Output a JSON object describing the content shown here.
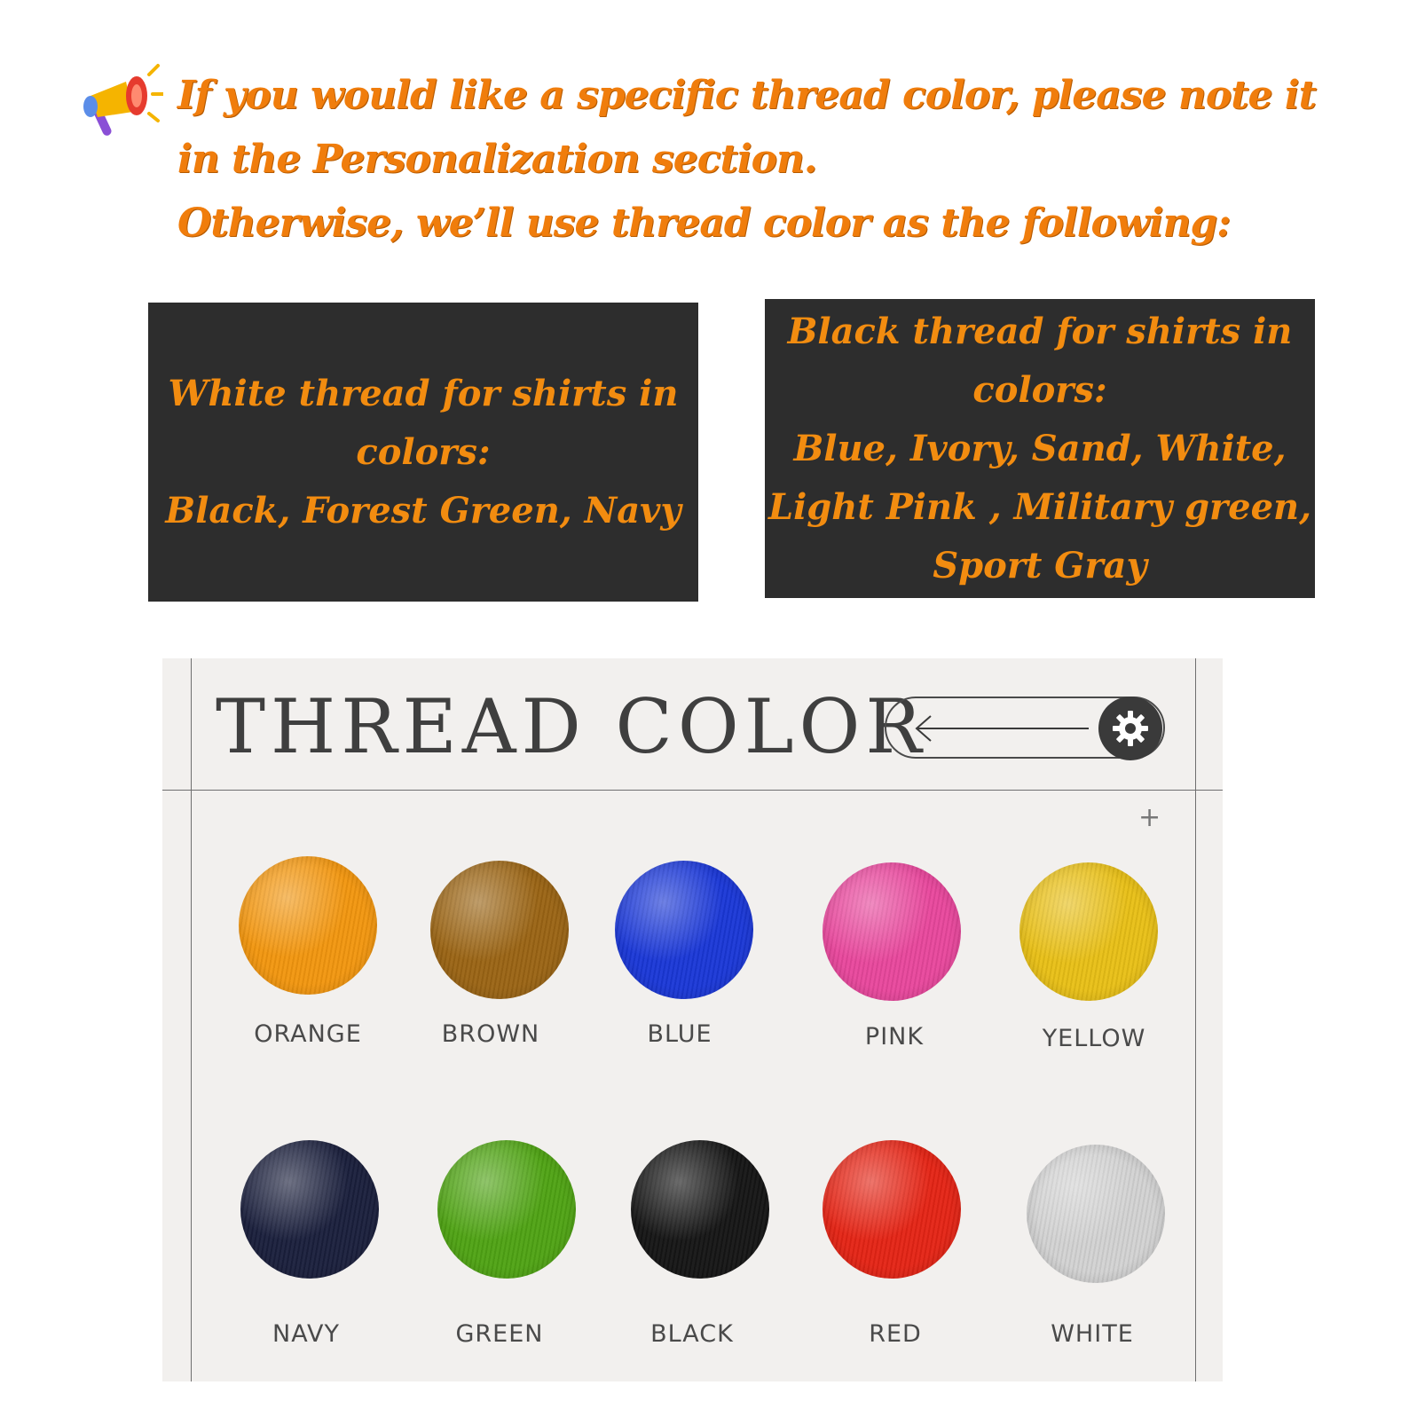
{
  "notice": {
    "icon": "megaphone-icon",
    "lines": [
      "If you would like a specific thread color, please note it",
      "in the Personalization section.",
      "Otherwise, we’ll use thread color as the following:"
    ]
  },
  "boxes": {
    "white_thread": {
      "lines": [
        "White thread for shirts in",
        "colors:",
        "Black, Forest Green, Navy"
      ]
    },
    "black_thread": {
      "lines": [
        "Black thread for shirts in",
        "colors:",
        "Blue, Ivory, Sand, White,",
        "Light Pink , Military green,",
        "Sport Gray"
      ]
    }
  },
  "panel": {
    "title": "THREAD COLOR",
    "toggle_icon": "arrow-left-icon",
    "settings_icon": "gear-icon",
    "plus_symbol": "+",
    "swatches": [
      {
        "label": "ORANGE",
        "color": "#f2960f"
      },
      {
        "label": "BROWN",
        "color": "#9a6414"
      },
      {
        "label": "BLUE",
        "color": "#1a37d6"
      },
      {
        "label": "PINK",
        "color": "#e8479c"
      },
      {
        "label": "YELLOW",
        "color": "#e8bf16"
      },
      {
        "label": "NAVY",
        "color": "#1a1f3c"
      },
      {
        "label": "GREEN",
        "color": "#4fa314"
      },
      {
        "label": "BLACK",
        "color": "#151515"
      },
      {
        "label": "RED",
        "color": "#e42415"
      },
      {
        "label": "WHITE",
        "color": "#d2d2d2"
      }
    ]
  }
}
